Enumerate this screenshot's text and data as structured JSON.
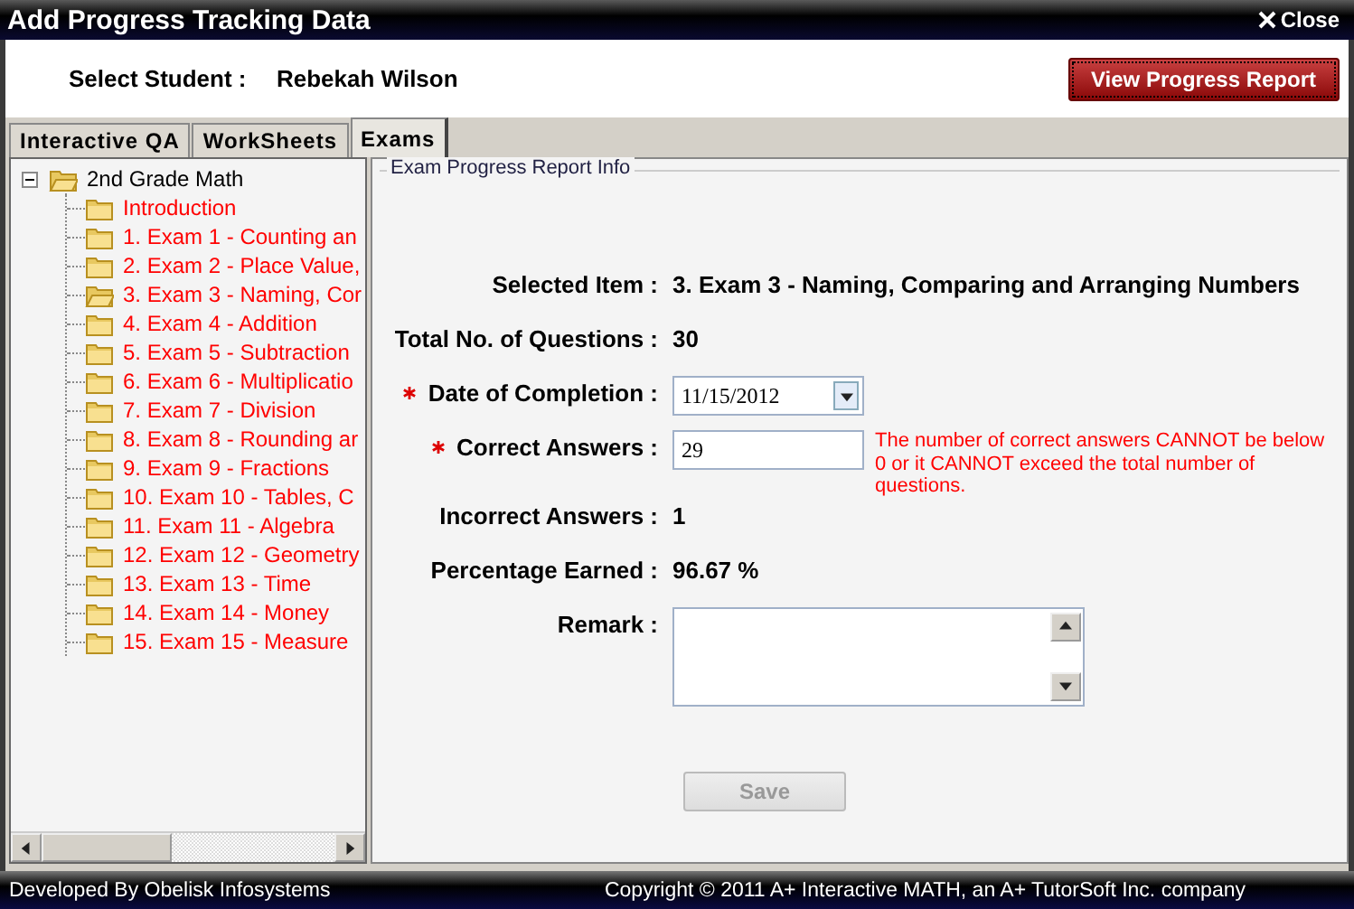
{
  "window": {
    "title": "Add Progress Tracking Data",
    "close": "Close"
  },
  "header": {
    "label": "Select Student :",
    "student": "Rebekah Wilson",
    "report_button": "View Progress Report"
  },
  "tabs": [
    {
      "label": "Interactive QA",
      "selected": false
    },
    {
      "label": "WorkSheets",
      "selected": false
    },
    {
      "label": "Exams",
      "selected": true
    }
  ],
  "tree": {
    "label": "2nd Grade Math",
    "expanded": true,
    "children": [
      {
        "label": "Introduction",
        "selected": false
      },
      {
        "label": "1. Exam 1 - Counting an",
        "selected": false
      },
      {
        "label": "2. Exam 2 - Place Value,",
        "selected": false
      },
      {
        "label": "3. Exam 3 - Naming, Cor",
        "selected": true
      },
      {
        "label": "4. Exam 4 - Addition",
        "selected": false
      },
      {
        "label": "5. Exam 5 - Subtraction",
        "selected": false
      },
      {
        "label": "6. Exam 6 - Multiplicatio",
        "selected": false
      },
      {
        "label": "7. Exam 7 - Division",
        "selected": false
      },
      {
        "label": "8. Exam 8 - Rounding ar",
        "selected": false
      },
      {
        "label": "9. Exam 9 - Fractions",
        "selected": false
      },
      {
        "label": "10. Exam 10 - Tables, C",
        "selected": false
      },
      {
        "label": "11. Exam 11 - Algebra",
        "selected": false
      },
      {
        "label": "12. Exam 12 - Geometry",
        "selected": false
      },
      {
        "label": "13. Exam 13 - Time",
        "selected": false
      },
      {
        "label": "14. Exam 14 - Money",
        "selected": false
      },
      {
        "label": "15. Exam 15 - Measure",
        "selected": false
      }
    ]
  },
  "form": {
    "legend": "Exam Progress Report Info",
    "rows": [
      {
        "kind": "text",
        "label": "Selected Item :",
        "value": "3. Exam 3 - Naming, Comparing and Arranging Numbers",
        "required": false
      },
      {
        "kind": "text",
        "label": "Total No. of Questions :",
        "value": "30",
        "required": false
      },
      {
        "kind": "date",
        "label": "Date of Completion :",
        "value": "11/15/2012",
        "required": true
      },
      {
        "kind": "input",
        "label": "Correct Answers :",
        "value": "29",
        "required": true,
        "error": "The number of correct answers CANNOT be below 0 or it CANNOT exceed the total number of questions."
      },
      {
        "kind": "text",
        "label": "Incorrect Answers :",
        "value": "1",
        "required": false
      },
      {
        "kind": "text",
        "label": "Percentage Earned :",
        "value": "96.67 %",
        "required": false
      },
      {
        "kind": "textarea",
        "label": "Remark :",
        "value": "",
        "required": false
      }
    ],
    "save_button": {
      "label": "Save",
      "disabled": true
    }
  },
  "footer": {
    "left": "Developed By Obelisk Infosystems",
    "right": "Copyright © 2011 A+ Interactive MATH, an A+ TutorSoft Inc. company"
  }
}
